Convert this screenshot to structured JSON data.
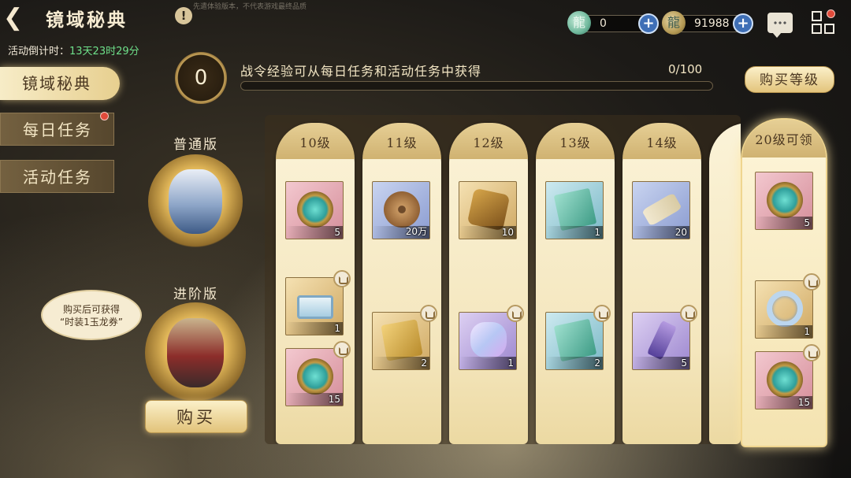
{
  "header": {
    "back_icon": "back-arrow-icon",
    "title": "镜域秘典",
    "watermark": "先遣体验版本，不代表游戏最终品质",
    "jade_value": "0",
    "gold_value": "91988"
  },
  "countdown": {
    "label": "活动倒计时：",
    "value": "13天23时29分"
  },
  "nav": {
    "items": [
      {
        "label": "镜域秘典",
        "active": true
      },
      {
        "label": "每日任务",
        "active": false,
        "dot": true
      },
      {
        "label": "活动任务",
        "active": false
      }
    ]
  },
  "tiers": {
    "normal_label": "普通版",
    "advanced_label": "进阶版",
    "speech_line1": "购买后可获得",
    "speech_line2": "“时装1玉龙券”",
    "buy_label": "购买"
  },
  "progress": {
    "level": "0",
    "description": "战令经验可从每日任务和活动任务中获得",
    "count": "0/100",
    "fraction": 0,
    "buy_level_label": "购买等级"
  },
  "columns": [
    {
      "level": "10级",
      "free": {
        "icon": "mirror",
        "qty": "5"
      },
      "paid": [
        {
          "icon": "frame",
          "qty": "1"
        },
        {
          "icon": "mirror",
          "qty": "15"
        }
      ]
    },
    {
      "level": "11级",
      "free": {
        "icon": "coin",
        "qty": "20万"
      },
      "paid": [
        {
          "icon": "gold-ticket",
          "qty": "2"
        }
      ]
    },
    {
      "level": "12级",
      "free": {
        "icon": "puzzle",
        "qty": "10"
      },
      "paid": [
        {
          "icon": "crystal",
          "qty": "1"
        }
      ]
    },
    {
      "level": "13级",
      "free": {
        "icon": "ticket",
        "qty": "1"
      },
      "paid": [
        {
          "icon": "ticket",
          "qty": "2"
        }
      ]
    },
    {
      "level": "14级",
      "free": {
        "icon": "scroll",
        "qty": "20"
      },
      "paid": [
        {
          "icon": "purple-scroll",
          "qty": "5"
        }
      ]
    }
  ],
  "final_column": {
    "level": "20级可领",
    "free": {
      "icon": "mirror",
      "qty": "5"
    },
    "paid": [
      {
        "icon": "ring",
        "qty": "1"
      },
      {
        "icon": "mirror",
        "qty": "15"
      }
    ]
  },
  "colors": {
    "accent_gold": "#e7cf8f",
    "countdown_green": "#6ee08a",
    "badge_red": "#e04a3a"
  }
}
